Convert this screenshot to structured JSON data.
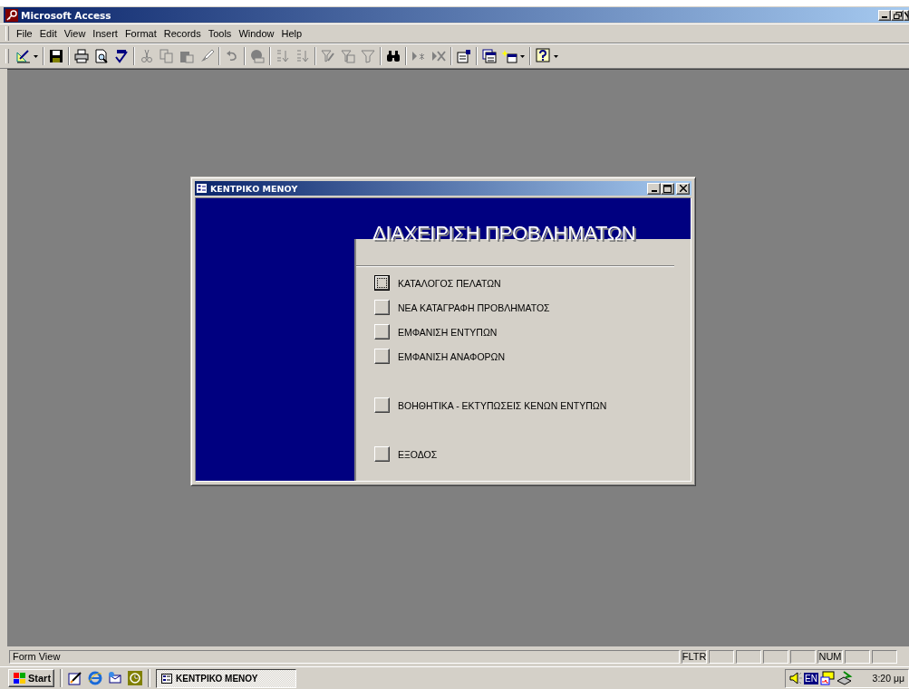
{
  "app": {
    "title": "Microsoft Access"
  },
  "menu": [
    {
      "label": "File"
    },
    {
      "label": "Edit"
    },
    {
      "label": "View"
    },
    {
      "label": "Insert"
    },
    {
      "label": "Format"
    },
    {
      "label": "Records"
    },
    {
      "label": "Tools"
    },
    {
      "label": "Window"
    },
    {
      "label": "Help"
    }
  ],
  "form": {
    "title": "ΚΕΝΤΡΙΚΟ ΜΕΝΟΥ",
    "heading": "ΔΙΑΧΕΙΡΙΣΗ ΠΡΟΒΛΗΜΑΤΩΝ",
    "groups": [
      [
        {
          "label": "ΚΑΤΑΛΟΓΟΣ ΠΕΛΑΤΩΝ",
          "selected": true
        },
        {
          "label": "ΝΕΑ ΚΑΤΑΓΡΑΦΗ ΠΡΟΒΛΗΜΑΤΟΣ",
          "selected": false
        },
        {
          "label": "ΕΜΦΑΝΙΣΗ ΕΝΤΥΠΩΝ",
          "selected": false
        },
        {
          "label": "ΕΜΦΑΝΙΣΗ ΑΝΑΦΟΡΩΝ",
          "selected": false
        }
      ],
      [
        {
          "label": "ΒΟΗΘΗΤΙΚΑ - ΕΚΤΥΠΩΣΕΙΣ ΚΕΝΩΝ ΕΝΤΥΠΩΝ",
          "selected": false
        }
      ],
      [
        {
          "label": "ΕΞΟΔΟΣ",
          "selected": false
        }
      ]
    ]
  },
  "status_bar": {
    "text": "Form View",
    "indicators": [
      {
        "kind": "label",
        "label": "FLTR"
      },
      {
        "kind": "blank"
      },
      {
        "kind": "blank"
      },
      {
        "kind": "blank"
      },
      {
        "kind": "blank"
      },
      {
        "kind": "label",
        "label": "NUM"
      },
      {
        "kind": "blank"
      },
      {
        "kind": "blank"
      }
    ]
  },
  "taskbar": {
    "start": "Start",
    "tasks": [
      {
        "label": "ΚΕΝΤΡΙΚΟ ΜΕΝΟΥ",
        "selected": true
      }
    ],
    "language": "EN",
    "clock": "3:20 μμ"
  }
}
